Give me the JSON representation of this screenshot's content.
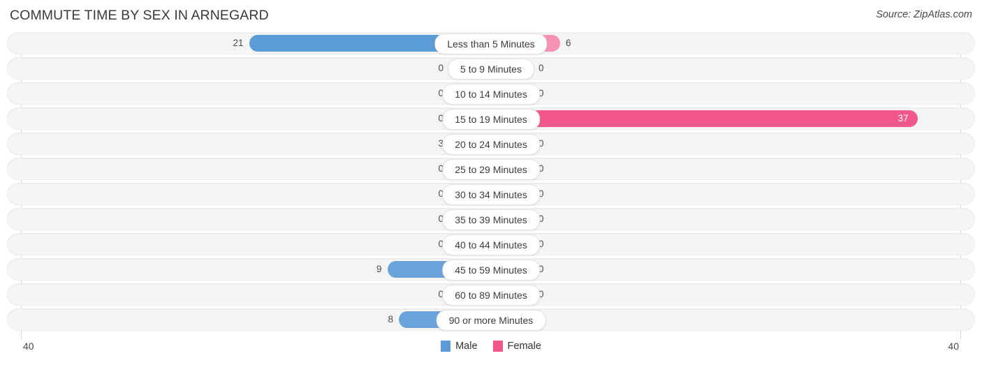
{
  "header": {
    "title": "COMMUTE TIME BY SEX IN ARNEGARD",
    "source": "Source: ZipAtlas.com"
  },
  "axis": {
    "left_tick": "40",
    "right_tick": "40",
    "max": 40
  },
  "legend": {
    "male_label": "Male",
    "female_label": "Female",
    "male_color": "#5b9bd8",
    "female_color": "#f2578c"
  },
  "chart_data": {
    "type": "bar",
    "title": "COMMUTE TIME BY SEX IN ARNEGARD",
    "subtitle": "Source: ZipAtlas.com",
    "orientation": "horizontal-diverging",
    "xlabel": "",
    "ylabel": "",
    "xlim": [
      40,
      40
    ],
    "grid": false,
    "legend_position": "bottom-center",
    "categories": [
      "Less than 5 Minutes",
      "5 to 9 Minutes",
      "10 to 14 Minutes",
      "15 to 19 Minutes",
      "20 to 24 Minutes",
      "25 to 29 Minutes",
      "30 to 34 Minutes",
      "35 to 39 Minutes",
      "40 to 44 Minutes",
      "45 to 59 Minutes",
      "60 to 89 Minutes",
      "90 or more Minutes"
    ],
    "series": [
      {
        "name": "Male",
        "values": [
          21,
          0,
          0,
          0,
          3,
          0,
          0,
          0,
          0,
          9,
          0,
          8
        ]
      },
      {
        "name": "Female",
        "values": [
          6,
          0,
          0,
          37,
          0,
          0,
          0,
          0,
          0,
          0,
          0,
          0
        ]
      }
    ]
  },
  "rows": [
    {
      "label": "Less than 5 Minutes",
      "male": "21",
      "female": "6",
      "male_value": 21,
      "female_value": 6
    },
    {
      "label": "5 to 9 Minutes",
      "male": "0",
      "female": "0",
      "male_value": 0,
      "female_value": 0
    },
    {
      "label": "10 to 14 Minutes",
      "male": "0",
      "female": "0",
      "male_value": 0,
      "female_value": 0
    },
    {
      "label": "15 to 19 Minutes",
      "male": "0",
      "female": "37",
      "male_value": 0,
      "female_value": 37
    },
    {
      "label": "20 to 24 Minutes",
      "male": "3",
      "female": "0",
      "male_value": 3,
      "female_value": 0
    },
    {
      "label": "25 to 29 Minutes",
      "male": "0",
      "female": "0",
      "male_value": 0,
      "female_value": 0
    },
    {
      "label": "30 to 34 Minutes",
      "male": "0",
      "female": "0",
      "male_value": 0,
      "female_value": 0
    },
    {
      "label": "35 to 39 Minutes",
      "male": "0",
      "female": "0",
      "male_value": 0,
      "female_value": 0
    },
    {
      "label": "40 to 44 Minutes",
      "male": "0",
      "female": "0",
      "male_value": 0,
      "female_value": 0
    },
    {
      "label": "45 to 59 Minutes",
      "male": "9",
      "female": "0",
      "male_value": 9,
      "female_value": 0
    },
    {
      "label": "60 to 89 Minutes",
      "male": "0",
      "female": "0",
      "male_value": 0,
      "female_value": 0
    },
    {
      "label": "90 or more Minutes",
      "male": "8",
      "female": "0",
      "male_value": 8,
      "female_value": 0
    }
  ]
}
